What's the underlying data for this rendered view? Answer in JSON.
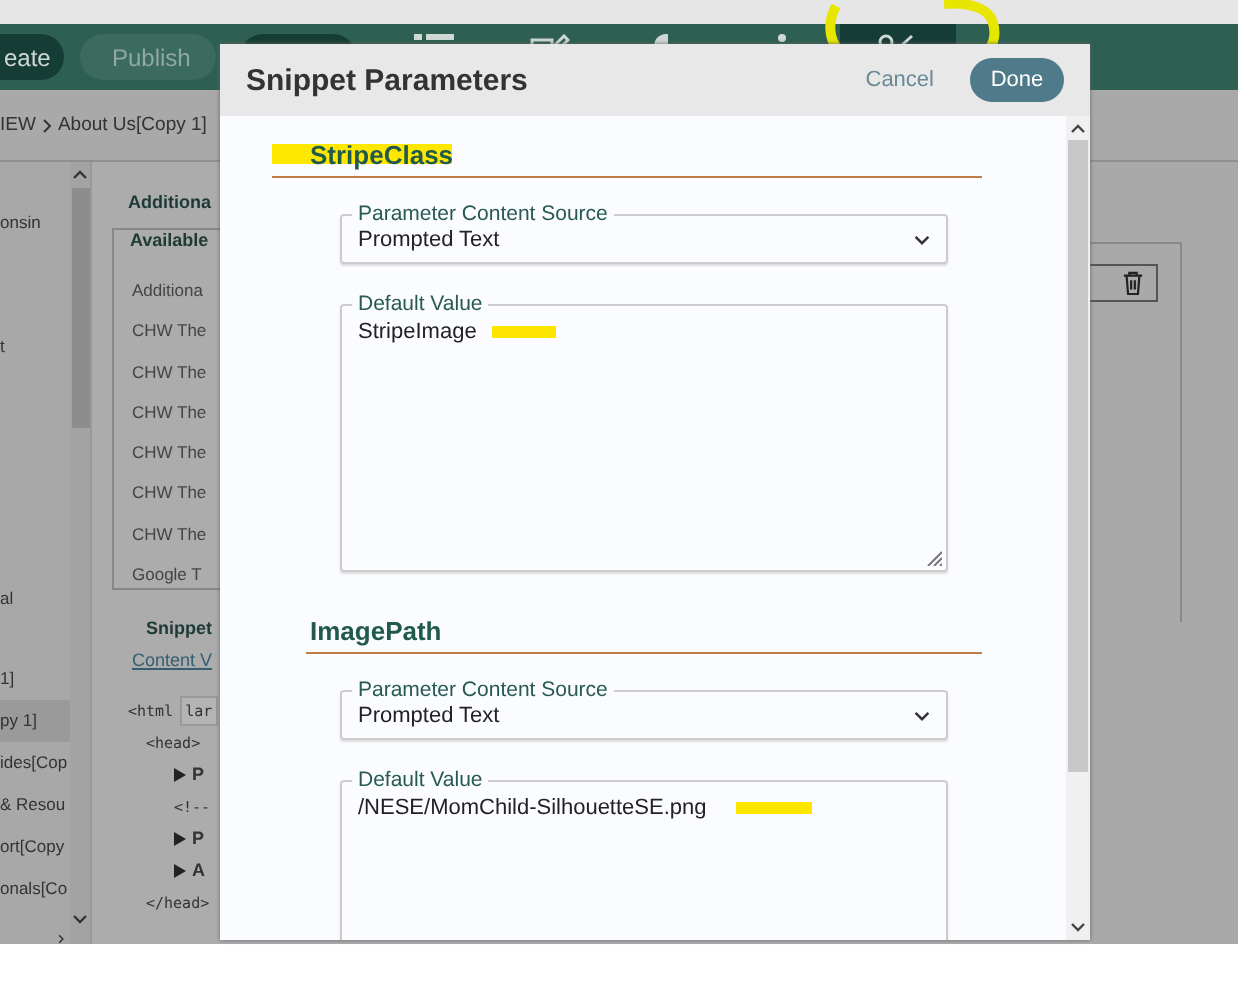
{
  "toolbar": {
    "buttons": [
      {
        "label": "eate",
        "kind": "dark"
      },
      {
        "label": "Publish",
        "kind": "dropdown"
      },
      {
        "kind": "dark"
      }
    ],
    "tools": [
      {
        "kind": "list",
        "selected": false,
        "circled": false
      },
      {
        "kind": "edit",
        "selected": false,
        "circled": false
      },
      {
        "kind": "wrench",
        "selected": false,
        "circled": false
      },
      {
        "kind": "more",
        "selected": false,
        "circled": false
      },
      {
        "kind": "scissors",
        "selected": true,
        "circled": true
      }
    ]
  },
  "breadcrumb": [
    "IEW",
    "About Us[Copy 1]"
  ],
  "sidebar": {
    "items": [
      {
        "label": "onsin",
        "selected": false
      },
      {
        "label": "t",
        "selected": false
      },
      {
        "label": "al",
        "selected": false
      },
      {
        "label": "1]",
        "selected": false
      },
      {
        "label": "py 1]",
        "selected": true
      },
      {
        "label": "ides[Cop",
        "selected": false
      },
      {
        "label": "& Resou",
        "selected": false
      },
      {
        "label": "ort[Copy",
        "selected": false
      },
      {
        "label": "onals[Co",
        "selected": false
      }
    ]
  },
  "panel": {
    "heading": "Additiona",
    "available": {
      "title": "Available",
      "items": [
        "Additiona",
        "CHW The",
        "CHW The",
        "CHW The",
        "CHW The",
        "CHW The",
        "CHW The",
        "Google T"
      ]
    },
    "snippet_title": "Snippet",
    "content_link": "Content V",
    "code": [
      {
        "text": "<html",
        "attr": "lar",
        "children": [
          {
            "text": "<head>",
            "children": [
              {
                "text": "P",
                "kind": "collapsed"
              },
              {
                "text": "<!--",
                "kind": "plain"
              },
              {
                "text": "P",
                "kind": "collapsed"
              },
              {
                "text": "A",
                "kind": "collapsed"
              }
            ]
          },
          {
            "text": "</head>"
          }
        ]
      }
    ]
  },
  "modal": {
    "title": "Snippet Parameters",
    "cancel": "Cancel",
    "done": "Done",
    "parameters": [
      {
        "name": "StripeClass",
        "name_highlighted": true,
        "source_label": "Parameter Content Source",
        "source": "Prompted Text",
        "value_label": "Default Value",
        "value": "StripeImage",
        "value_highlighted": true
      },
      {
        "name": "ImagePath",
        "name_highlighted": false,
        "source_label": "Parameter Content Source",
        "source": "Prompted Text",
        "value_label": "Default Value",
        "value": "/NESE/MomChild-SilhouetteSE.png",
        "value_highlighted": true
      }
    ]
  }
}
